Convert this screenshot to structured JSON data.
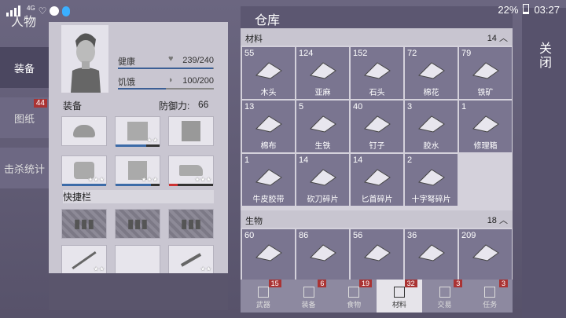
{
  "status_bar": {
    "network": "4G",
    "battery": "22%",
    "time": "03:27"
  },
  "character": {
    "title": "人物",
    "tabs": [
      {
        "label": "装备",
        "badge": ""
      },
      {
        "label": "图纸",
        "badge": "44"
      },
      {
        "label": "击杀统计",
        "badge": ""
      }
    ],
    "health_label": "健康",
    "health_value": "239/240",
    "health_fraction": 0.99,
    "hunger_label": "饥饿",
    "hunger_value": "100/200",
    "hunger_fraction": 0.5,
    "equip_label": "装备",
    "defense_label": "防御力:",
    "defense_value": "66",
    "quickbar_label": "快捷栏"
  },
  "warehouse": {
    "title": "仓库",
    "close_label": "关闭",
    "categories": [
      {
        "name": "材料",
        "count": "14",
        "items": [
          {
            "qty": "55",
            "name": "木头",
            "icon": "log-icon"
          },
          {
            "qty": "124",
            "name": "亚麻",
            "icon": "flax-icon"
          },
          {
            "qty": "152",
            "name": "石头",
            "icon": "stone-icon"
          },
          {
            "qty": "72",
            "name": "棉花",
            "icon": "cotton-icon"
          },
          {
            "qty": "79",
            "name": "铁矿",
            "icon": "iron-ore-icon"
          },
          {
            "qty": "13",
            "name": "棉布",
            "icon": "cloth-icon"
          },
          {
            "qty": "5",
            "name": "生铁",
            "icon": "iron-icon"
          },
          {
            "qty": "40",
            "name": "钉子",
            "icon": "nails-icon"
          },
          {
            "qty": "3",
            "name": "胶水",
            "icon": "glue-icon"
          },
          {
            "qty": "1",
            "name": "修理箱",
            "icon": "repair-kit-icon"
          },
          {
            "qty": "1",
            "name": "牛皮胶带",
            "icon": "tape-icon"
          },
          {
            "qty": "14",
            "name": "砍刀碎片",
            "icon": "machete-shard-icon"
          },
          {
            "qty": "14",
            "name": "匕首碎片",
            "icon": "dagger-shard-icon"
          },
          {
            "qty": "2",
            "name": "十字弩碎片",
            "icon": "crossbow-shard-icon"
          }
        ]
      },
      {
        "name": "生物",
        "count": "18",
        "items": [
          {
            "qty": "60",
            "name": "",
            "icon": "guts-icon"
          },
          {
            "qty": "86",
            "name": "",
            "icon": "bones-icon"
          },
          {
            "qty": "56",
            "name": "",
            "icon": "hair-icon"
          },
          {
            "qty": "36",
            "name": "",
            "icon": "shell-icon"
          },
          {
            "qty": "209",
            "name": "",
            "icon": "feather-icon"
          }
        ]
      }
    ],
    "bottom_tabs": [
      {
        "label": "武器",
        "badge": "15"
      },
      {
        "label": "装备",
        "badge": "6"
      },
      {
        "label": "食物",
        "badge": "19"
      },
      {
        "label": "材料",
        "badge": "32"
      },
      {
        "label": "交易",
        "badge": "3"
      },
      {
        "label": "任务",
        "badge": "3"
      }
    ]
  }
}
